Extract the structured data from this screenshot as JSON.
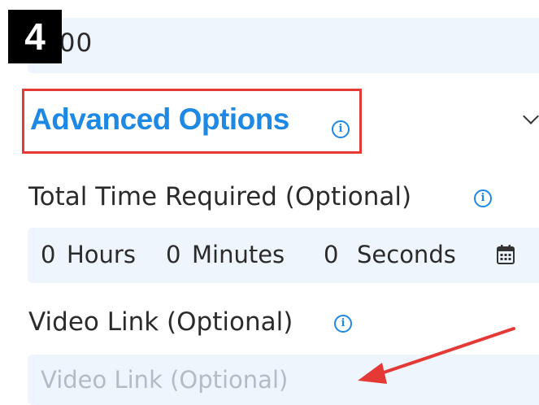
{
  "annotation": {
    "step_number": "4"
  },
  "target_field": {
    "value": "000"
  },
  "advanced_options": {
    "title": "Advanced Options",
    "info_icon": "info-icon",
    "expand_icon": "chevron-down-icon"
  },
  "total_time": {
    "label": "Total Time Required (Optional)",
    "hours_value": "0",
    "hours_label": "Hours",
    "minutes_value": "0",
    "minutes_label": "Minutes",
    "seconds_value": "0",
    "seconds_label": "Seconds",
    "picker_icon": "calendar-icon"
  },
  "video_link": {
    "label": "Video Link (Optional)",
    "placeholder": "Video Link (Optional)"
  },
  "colors": {
    "accent": "#1e88e5",
    "highlight_box": "#e53935",
    "arrow": "#e53935",
    "field_bg": "#eef5fc"
  }
}
